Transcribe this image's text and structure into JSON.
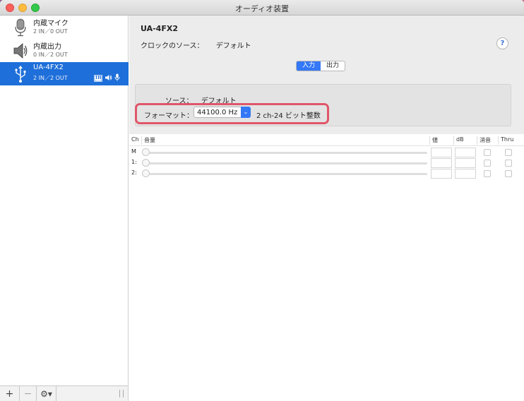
{
  "window": {
    "title": "オーディオ装置"
  },
  "sidebar": {
    "devices": [
      {
        "name": "内蔵マイク",
        "io": "2 IN／0 OUT",
        "icon": "microphone-icon"
      },
      {
        "name": "内蔵出力",
        "io": "0 IN／2 OUT",
        "icon": "speaker-icon"
      },
      {
        "name": "UA-4FX2",
        "io": "2 IN／2 OUT",
        "icon": "usb-icon",
        "selected": true
      }
    ],
    "toolbar": {
      "add": "+",
      "remove": "−",
      "gear_menu": "⚙▾"
    }
  },
  "main": {
    "device_title": "UA-4FX2",
    "clock_source_label": "クロックのソース：",
    "clock_source_value": "デフォルト",
    "help": "?",
    "tabs": [
      {
        "label": "入力",
        "active": true
      },
      {
        "label": "出力",
        "active": false
      }
    ],
    "source_label": "ソース：",
    "source_value": "デフォルト",
    "format_label": "フォーマット：",
    "format_value": "44100.0 Hz",
    "format_bits": "2 ch-24 ビット整数"
  },
  "table": {
    "headers": {
      "ch": "Ch",
      "volume": "音量",
      "value": "値",
      "db": "dB",
      "mute": "消音",
      "thru": "Thru"
    },
    "rows": [
      {
        "ch": "M"
      },
      {
        "ch": "1:"
      },
      {
        "ch": "2:"
      }
    ]
  },
  "colors": {
    "accent": "#3478f6",
    "selection": "#1e6fd9",
    "highlight": "#e0566a"
  }
}
